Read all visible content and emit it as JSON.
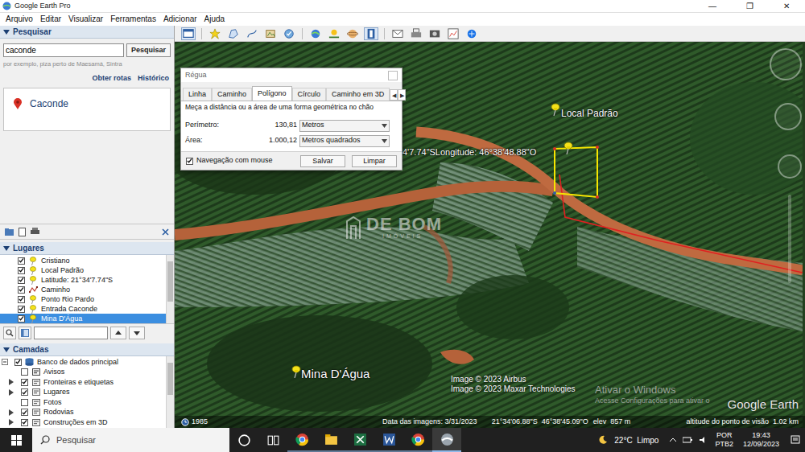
{
  "window": {
    "title": "Google Earth Pro",
    "controls": [
      "—",
      "❐",
      "✕"
    ]
  },
  "menu": [
    "Arquivo",
    "Editar",
    "Visualizar",
    "Ferramentas",
    "Adicionar",
    "Ajuda"
  ],
  "search_panel": {
    "header": "Pesquisar",
    "expanded": true,
    "query": "caconde",
    "button": "Pesquisar",
    "hint": "por exemplo, piza perto de Maesamá, Sintra",
    "links": [
      "Obter rotas",
      "Histórico"
    ],
    "results": [
      {
        "label": "Caconde"
      }
    ]
  },
  "places": {
    "header": "Lugares",
    "expanded": true,
    "items": [
      {
        "label": "Cristiano",
        "kind": "placemark",
        "checked": true,
        "selected": false
      },
      {
        "label": "Local Padrão",
        "kind": "placemark",
        "checked": true,
        "selected": false
      },
      {
        "label": "Latitude: 21°34'7.74\"S",
        "kind": "placemark",
        "checked": true,
        "selected": false
      },
      {
        "label": "Caminho",
        "kind": "path",
        "checked": true,
        "selected": false
      },
      {
        "label": "Ponto Rio Pardo",
        "kind": "placemark",
        "checked": true,
        "selected": false
      },
      {
        "label": "Entrada Caconde",
        "kind": "placemark",
        "checked": true,
        "selected": false
      },
      {
        "label": "Mina D'Água",
        "kind": "placemark",
        "checked": true,
        "selected": true
      }
    ]
  },
  "layers": {
    "header": "Camadas",
    "expanded": true,
    "items": [
      {
        "label": "Banco de dados principal",
        "kind": "database",
        "checked": true,
        "expandable": true,
        "expanded": true
      },
      {
        "label": "Avisos",
        "kind": "alerts",
        "checked": false,
        "expandable": false,
        "expanded": false
      },
      {
        "label": "Fronteiras e etiquetas",
        "kind": "borders",
        "checked": true,
        "expandable": true,
        "expanded": false
      },
      {
        "label": "Lugares",
        "kind": "places",
        "checked": true,
        "expandable": true,
        "expanded": false
      },
      {
        "label": "Fotos",
        "kind": "photos",
        "checked": false,
        "expandable": false,
        "expanded": false
      },
      {
        "label": "Rodovias",
        "kind": "roads",
        "checked": true,
        "expandable": true,
        "expanded": false
      },
      {
        "label": "Construções em 3D",
        "kind": "buildings",
        "checked": true,
        "expandable": true,
        "expanded": false
      }
    ]
  },
  "ruler": {
    "title": "Régua",
    "tabs": [
      {
        "label": "Linha",
        "selected": false
      },
      {
        "label": "Caminho",
        "selected": false
      },
      {
        "label": "Polígono",
        "selected": true
      },
      {
        "label": "Círculo",
        "selected": false
      },
      {
        "label": "Caminho em 3D",
        "selected": false
      }
    ],
    "scroll": [
      "◀",
      "▶"
    ],
    "description": "Meça a distância ou a área de uma forma geométrica no chão",
    "rows": [
      {
        "label": "Perímetro:",
        "value": "130,81",
        "unit": "Metros"
      },
      {
        "label": "Área:",
        "value": "1.000,12",
        "unit": "Metros quadrados"
      }
    ],
    "mouse_nav": {
      "label": "Navegação com mouse",
      "checked": true
    },
    "buttons": [
      "Salvar",
      "Limpar"
    ]
  },
  "map": {
    "pins": [
      {
        "label": "Local Padrão"
      },
      {
        "label": "Mina D'Água"
      }
    ],
    "coordinate_label": "4'7.74\"SLongitude: 46°38'48.88\"O",
    "watermark": {
      "title": "DE BOM",
      "subtitle": "IMÓVEIS"
    },
    "credits": [
      "Image © 2023 Airbus",
      "Image © 2023 Maxar Technologies"
    ],
    "activation": {
      "title": "Ativar o Windows",
      "subtitle": "Acesse Configurações para ativar o"
    },
    "logo": "Google Earth",
    "year": "1985"
  },
  "status_bar": {
    "date": "Data das imagens: 3/31/2023",
    "lat": "21°34'06.88\"S",
    "lon": "46°38'45.09\"O",
    "elev": "elev  857 m",
    "eye": "altitude do ponto de visão  1.02 km"
  },
  "taskbar": {
    "search": "Pesquisar",
    "weather": "22°C  Limpo",
    "lang": [
      "POR",
      "PTB2"
    ],
    "time": "19:43",
    "date": "12/09/2023"
  }
}
